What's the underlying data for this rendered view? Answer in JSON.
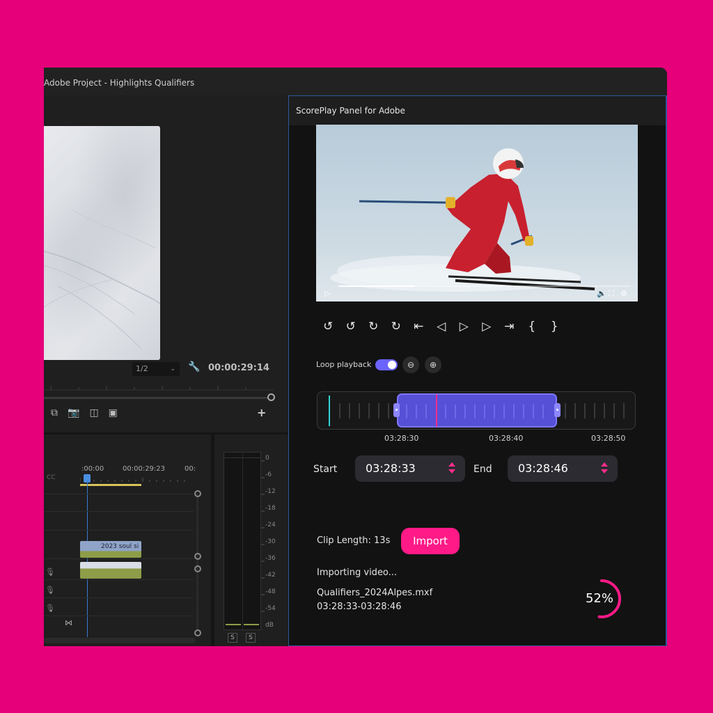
{
  "window": {
    "title": "Adobe Project - Highlights Qualifiers"
  },
  "program_monitor": {
    "zoom_value": "1/2",
    "timecode": "00:00:29:14"
  },
  "timeline": {
    "cc_label": "CC",
    "time_start": ":00:00",
    "time_mid": "00:00:29:23",
    "time_end": "00:",
    "clip_label": "2023 soul si"
  },
  "audio_meter": {
    "scale": [
      "0",
      "-6",
      "-12",
      "-18",
      "-24",
      "-30",
      "-36",
      "-42",
      "-48",
      "-54",
      "dB"
    ],
    "solo_left": "S",
    "solo_right": "S"
  },
  "panel": {
    "title": "ScorePlay Panel for Adobe",
    "video_progress": 0.26,
    "transport_icons": [
      "rewind-5-icon",
      "rewind-10-icon",
      "forward-10-icon",
      "forward-5-icon",
      "go-to-in-icon",
      "step-back-icon",
      "play-icon",
      "step-forward-icon",
      "go-to-out-icon",
      "mark-in-icon",
      "mark-out-icon"
    ],
    "loop_label": "Loop playback",
    "loop_enabled": true,
    "range_labels": [
      "03:28:30",
      "03:28:40",
      "03:28:50"
    ],
    "start_label": "Start",
    "start_value": "03:28:33",
    "end_label": "End",
    "end_value": "03:28:46",
    "clip_length": "Clip Length: 13s",
    "import_label": "Import",
    "status_text": "Importing video...",
    "file_name": "Qualifiers_2024Alpes.mxf",
    "file_range": "03:28:33-03:28:46",
    "progress_percent": 52,
    "progress_text": "52%",
    "accent_color": "#FF1A87",
    "selection_color": "#5650D6"
  }
}
